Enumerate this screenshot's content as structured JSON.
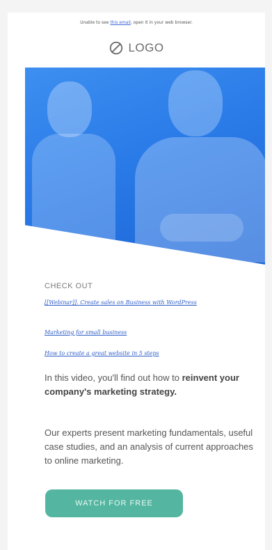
{
  "preheader": {
    "before": "Unable to see ",
    "link": "this email",
    "after": ", open it in your web browser."
  },
  "logo": {
    "text": "LOGO"
  },
  "section": {
    "label": "CHECK OUT"
  },
  "links": [
    {
      "text": "[[Webinar]]. Create sales on Business with WordPress"
    },
    {
      "text": "Marketing for small business"
    },
    {
      "text": "How to create a great website in 5 steps"
    }
  ],
  "intro": {
    "text": "In this video, you'll find out how to ",
    "bold": "reinvent your company's marketing strategy."
  },
  "body": {
    "text": "Our experts present marketing fundamentals, useful case studies, and an analysis of current approaches to online marketing."
  },
  "cta": {
    "label": "WATCH FOR FREE"
  },
  "colors": {
    "accent": "#54b5a0",
    "hero": "#2a7be8",
    "link": "#2f5ec8"
  }
}
